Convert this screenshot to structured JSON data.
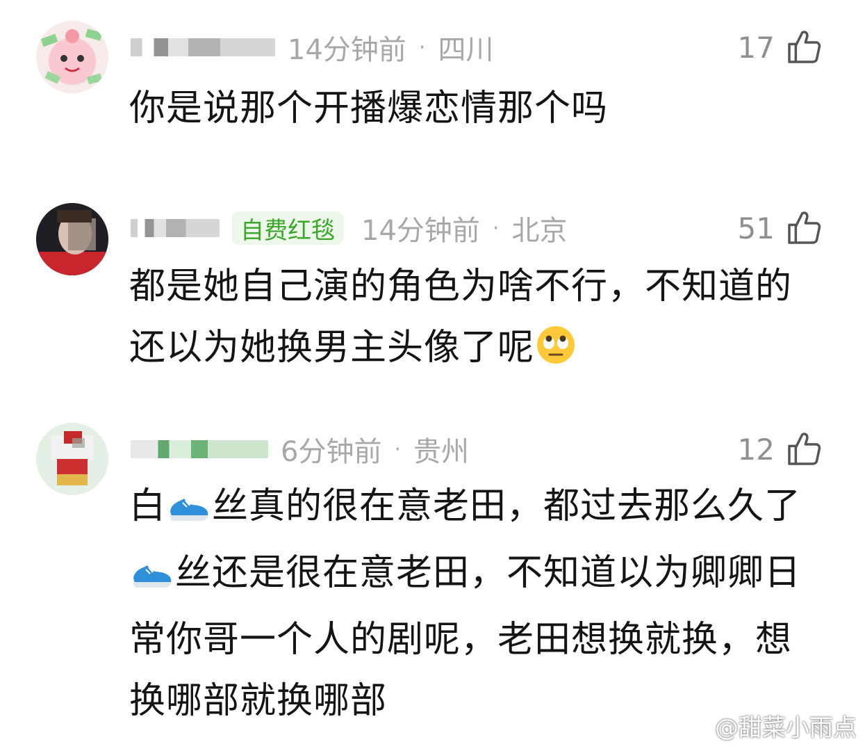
{
  "comments": [
    {
      "time": "14分钟前",
      "dot": "·",
      "location": "四川",
      "likes": "17",
      "text": "你是说那个开播爆恋情那个吗"
    },
    {
      "badge": "自费红毯",
      "time": "14分钟前",
      "dot": "·",
      "location": "北京",
      "likes": "51",
      "text_line1": "都是她自己演的角色为啥不行，不知道的",
      "text_line2": "还以为她换男主头像了呢"
    },
    {
      "time": "6分钟前",
      "dot": "·",
      "location": "贵州",
      "likes": "12",
      "seg1": "白",
      "seg2": "丝真的很在意老田，都过去那么久了",
      "seg3": "丝还是很在意老田，不知道以为卿卿日",
      "seg4": "常你哥一个人的剧呢，老田想换就换，想",
      "seg5": "换哪部就换哪部"
    }
  ],
  "watermark": "@甜菜小雨点",
  "icons": {
    "like": "thumbs-up-icon",
    "emoji_eyeroll": "eye-roll-emoji",
    "emoji_shoe": "running-shoe-emoji",
    "weibo_logo": "weibo-icon"
  },
  "colors": {
    "badge_text": "#3aa62b",
    "badge_bg": "#eef8ea",
    "meta_text": "#a8a8a8"
  }
}
